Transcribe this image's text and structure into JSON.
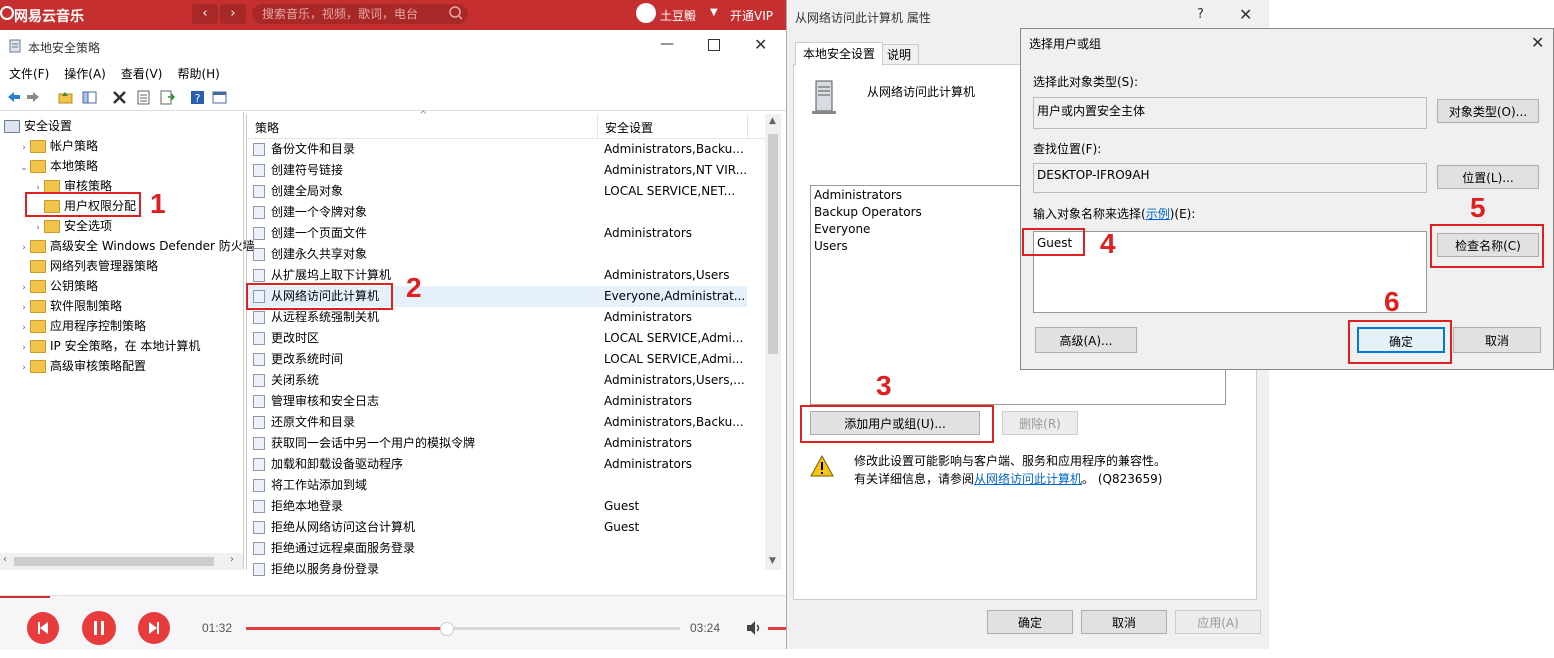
{
  "netease": {
    "logo": "网易云音乐",
    "back": "‹",
    "forward": "›",
    "search_placeholder": "搜索音乐，视频，歌词，电台",
    "user": "土豆毈",
    "vip": "开通VIP",
    "time_current": "01:32",
    "time_total": "03:24",
    "progress": 0.46
  },
  "lsp": {
    "title": "本地安全策略",
    "menu": [
      "文件(F)",
      "操作(A)",
      "查看(V)",
      "帮助(H)"
    ],
    "tree": [
      {
        "label": "安全设置",
        "level": 0,
        "chev": ""
      },
      {
        "label": "帐户策略",
        "level": 1,
        "chev": "›"
      },
      {
        "label": "本地策略",
        "level": 1,
        "chev": "⌄"
      },
      {
        "label": "审核策略",
        "level": 2,
        "chev": "›"
      },
      {
        "label": "用户权限分配",
        "level": 2,
        "chev": ""
      },
      {
        "label": "安全选项",
        "level": 2,
        "chev": "›"
      },
      {
        "label": "高级安全 Windows Defender 防火墙",
        "level": 1,
        "chev": "›"
      },
      {
        "label": "网络列表管理器策略",
        "level": 1,
        "chev": ""
      },
      {
        "label": "公钥策略",
        "level": 1,
        "chev": "›"
      },
      {
        "label": "软件限制策略",
        "level": 1,
        "chev": "›"
      },
      {
        "label": "应用程序控制策略",
        "level": 1,
        "chev": "›"
      },
      {
        "label": "IP 安全策略，在 本地计算机",
        "level": 1,
        "chev": "›"
      },
      {
        "label": "高级审核策略配置",
        "level": 1,
        "chev": "›"
      }
    ],
    "col_policy": "策略",
    "col_setting": "安全设置",
    "rows": [
      {
        "policy": "备份文件和目录",
        "setting": "Administrators,Backu..."
      },
      {
        "policy": "创建符号链接",
        "setting": "Administrators,NT VIR..."
      },
      {
        "policy": "创建全局对象",
        "setting": "LOCAL SERVICE,NET..."
      },
      {
        "policy": "创建一个令牌对象",
        "setting": ""
      },
      {
        "policy": "创建一个页面文件",
        "setting": "Administrators"
      },
      {
        "policy": "创建永久共享对象",
        "setting": ""
      },
      {
        "policy": "从扩展坞上取下计算机",
        "setting": "Administrators,Users"
      },
      {
        "policy": "从网络访问此计算机",
        "setting": "Everyone,Administrat..."
      },
      {
        "policy": "从远程系统强制关机",
        "setting": "Administrators"
      },
      {
        "policy": "更改时区",
        "setting": "LOCAL SERVICE,Admi..."
      },
      {
        "policy": "更改系统时间",
        "setting": "LOCAL SERVICE,Admi..."
      },
      {
        "policy": "关闭系统",
        "setting": "Administrators,Users,..."
      },
      {
        "policy": "管理审核和安全日志",
        "setting": "Administrators"
      },
      {
        "policy": "还原文件和目录",
        "setting": "Administrators,Backu..."
      },
      {
        "policy": "获取同一会话中另一个用户的模拟令牌",
        "setting": "Administrators"
      },
      {
        "policy": "加载和卸载设备驱动程序",
        "setting": "Administrators"
      },
      {
        "policy": "将工作站添加到域",
        "setting": ""
      },
      {
        "policy": "拒绝本地登录",
        "setting": "Guest"
      },
      {
        "policy": "拒绝从网络访问这台计算机",
        "setting": "Guest"
      },
      {
        "policy": "拒绝通过远程桌面服务登录",
        "setting": ""
      },
      {
        "policy": "拒绝以服务身份登录",
        "setting": ""
      }
    ]
  },
  "props": {
    "title": "从网络访问此计算机 属性",
    "help": "?",
    "tab_local": "本地安全设置",
    "tab_explain": "说明",
    "heading": "从网络访问此计算机",
    "members": [
      "Administrators",
      "Backup Operators",
      "Everyone",
      "Users"
    ],
    "add_btn": "添加用户或组(U)...",
    "remove_btn": "删除(R)",
    "warn_line1": "修改此设置可能影响与客户端、服务和应用程序的兼容性。",
    "warn_line2_pre": "有关详细信息，请参阅",
    "warn_link": "从网络访问此计算机",
    "warn_line2_post": "。 (Q823659)",
    "ok": "确定",
    "cancel": "取消",
    "apply": "应用(A)"
  },
  "sel": {
    "title": "选择用户或组",
    "type_label": "选择此对象类型(S):",
    "type_value": "用户或内置安全主体",
    "type_btn": "对象类型(O)...",
    "loc_label": "查找位置(F):",
    "loc_value": "DESKTOP-IFRO9AH",
    "loc_btn": "位置(L)...",
    "enter_label_pre": "输入对象名称来选择(",
    "enter_link": "示例",
    "enter_label_post": ")(E):",
    "enter_value": "Guest",
    "check_btn": "检查名称(C)",
    "adv_btn": "高级(A)...",
    "ok": "确定",
    "cancel": "取消"
  },
  "steps": [
    "1",
    "2",
    "3",
    "4",
    "5",
    "6"
  ]
}
